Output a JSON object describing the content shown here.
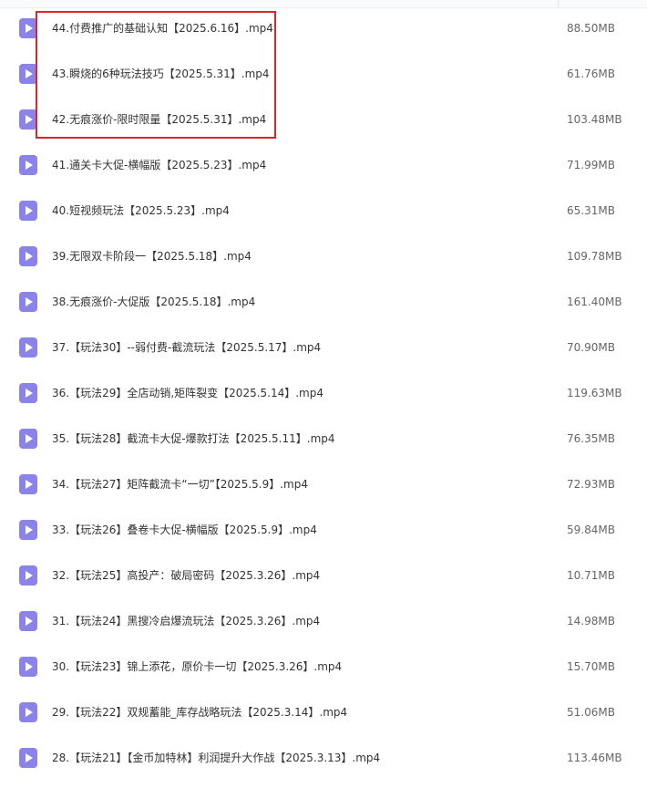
{
  "files": [
    {
      "name": "44.付费推广的基础认知【2025.6.16】.mp4",
      "size": "88.50MB"
    },
    {
      "name": "43.瞬烧的6种玩法技巧【2025.5.31】.mp4",
      "size": "61.76MB"
    },
    {
      "name": "42.无痕涨价-限时限量【2025.5.31】.mp4",
      "size": "103.48MB"
    },
    {
      "name": "41.通关卡大促-横幅版【2025.5.23】.mp4",
      "size": "71.99MB"
    },
    {
      "name": "40.短视频玩法【2025.5.23】.mp4",
      "size": "65.31MB"
    },
    {
      "name": "39.无限双卡阶段一【2025.5.18】.mp4",
      "size": "109.78MB"
    },
    {
      "name": "38.无痕涨价-大促版【2025.5.18】.mp4",
      "size": "161.40MB"
    },
    {
      "name": "37.【玩法30】--弱付费-截流玩法【2025.5.17】.mp4",
      "size": "70.90MB"
    },
    {
      "name": "36.【玩法29】全店动销,矩阵裂变【2025.5.14】.mp4",
      "size": "119.63MB"
    },
    {
      "name": "35.【玩法28】截流卡大促-爆款打法【2025.5.11】.mp4",
      "size": "76.35MB"
    },
    {
      "name": "34.【玩法27】矩阵截流卡“一切”【2025.5.9】.mp4",
      "size": "72.93MB"
    },
    {
      "name": "33.【玩法26】叠卷卡大促-横幅版【2025.5.9】.mp4",
      "size": "59.84MB"
    },
    {
      "name": "32.【玩法25】高投产：破局密码【2025.3.26】.mp4",
      "size": "10.71MB"
    },
    {
      "name": "31.【玩法24】黑搜冷启爆流玩法【2025.3.26】.mp4",
      "size": "14.98MB"
    },
    {
      "name": "30.【玩法23】锦上添花，原价卡一切【2025.3.26】.mp4",
      "size": "15.70MB"
    },
    {
      "name": "29.【玩法22】双规蓄能_库存战略玩法【2025.3.14】.mp4",
      "size": "51.06MB"
    },
    {
      "name": "28.【玩法21】【金币加特林】利润提升大作战【2025.3.13】.mp4",
      "size": "113.46MB"
    }
  ],
  "colors": {
    "icon": "#8b82ea",
    "highlight": "#d9262c"
  }
}
